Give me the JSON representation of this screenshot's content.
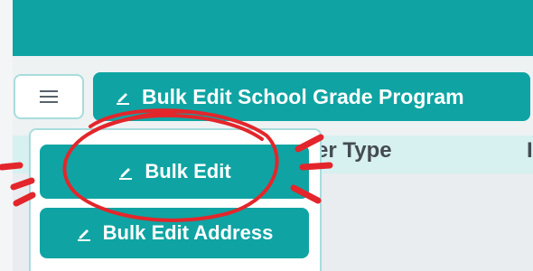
{
  "toolbar": {
    "primary_button_label": "Bulk Edit School Grade Program"
  },
  "table": {
    "column_headers": [
      "er Type",
      "I"
    ]
  },
  "dropdown_menu": {
    "items": [
      {
        "label": "Bulk Edit",
        "icon": "pencil-icon"
      },
      {
        "label": "Bulk Edit Address",
        "icon": "pencil-icon"
      }
    ]
  },
  "colors": {
    "accent": "#0fa4a3",
    "header_row": "#d7f0f0",
    "annotation": "#e3262b"
  }
}
